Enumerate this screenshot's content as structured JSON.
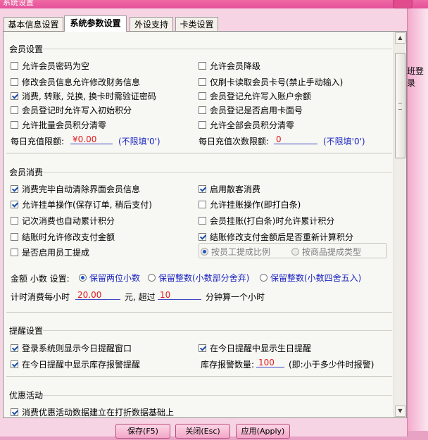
{
  "window": {
    "title": "系统设置"
  },
  "background": {
    "right_label": "班登录"
  },
  "tabs": [
    {
      "label": "基本信息设置"
    },
    {
      "label": "系统参数设置"
    },
    {
      "label": "外设支持"
    },
    {
      "label": "卡类设置"
    }
  ],
  "member_settings": {
    "title": "会员设置",
    "options": [
      {
        "label": "允许会员密码为空",
        "checked": false
      },
      {
        "label": "允许会员降级",
        "checked": false
      },
      {
        "label": "修改会员信息允许修改财务信息",
        "checked": false
      },
      {
        "label": "仅刷卡读取会员卡号(禁止手动输入)",
        "checked": false
      },
      {
        "label": "消费, 转账, 兑换, 换卡时需验证密码",
        "checked": true
      },
      {
        "label": "会员登记允许写入账户余额",
        "checked": false
      },
      {
        "label": "会员登记时允许写入初始积分",
        "checked": false
      },
      {
        "label": "会员登记是否启用卡面号",
        "checked": false
      },
      {
        "label": "允许批量会员积分清零",
        "checked": false
      },
      {
        "label": "允许全部会员积分清零",
        "checked": false
      }
    ],
    "daily_limit_label": "每日充值限额:",
    "daily_limit_value": "¥0.00",
    "daily_limit_hint": "(不限填'0')",
    "daily_count_label": "每日充值次数限额:",
    "daily_count_value": "0",
    "daily_count_hint": "(不限填'0')"
  },
  "member_consume": {
    "title": "会员消费",
    "options": [
      {
        "label": "消费完毕自动清除界面会员信息",
        "checked": true
      },
      {
        "label": "启用散客消费",
        "checked": true
      },
      {
        "label": "允许挂单操作(保存订单, 稍后支付)",
        "checked": true
      },
      {
        "label": "允许挂账操作(即打白条)",
        "checked": false
      },
      {
        "label": "记次消费也自动累计积分",
        "checked": false
      },
      {
        "label": "会员挂账(打白条)时允许累计积分",
        "checked": false
      },
      {
        "label": "结账时允许修改支付金额",
        "checked": false
      },
      {
        "label": "结账修改支付金额后是否重新计算积分",
        "checked": true
      },
      {
        "label": "是否启用员工提成",
        "checked": false
      }
    ],
    "commission_options": [
      {
        "label": "按员工提成比例",
        "selected": true
      },
      {
        "label": "按商品提成类型",
        "selected": false
      }
    ],
    "decimal_label": "金额 小数 设置:",
    "decimal_options": [
      {
        "label": "保留两位小数",
        "selected": true
      },
      {
        "label": "保留整数(小数部分舍弃)",
        "selected": false
      },
      {
        "label": "保留整数(小数四舍五入)",
        "selected": false
      }
    ],
    "hourly_label": "计时消费每小时",
    "hourly_value": "20.00",
    "hourly_mid": "元, 超过",
    "minutes_value": "10",
    "minutes_suffix": "分钟算一个小时"
  },
  "reminder": {
    "title": "提醒设置",
    "options": [
      {
        "label": "登录系统则显示今日提醒窗口",
        "checked": true
      },
      {
        "label": "在今日提醒中显示生日提醒",
        "checked": true
      },
      {
        "label": "在今日提醒中显示库存报警提醒",
        "checked": true
      }
    ],
    "stock_label": "库存报警数量:",
    "stock_value": "100",
    "stock_hint": "(即:小于多少件时报警)"
  },
  "promotion": {
    "title": "优惠活动",
    "options": [
      {
        "label": "消费优惠活动数据建立在打折数据基础上",
        "checked": true
      }
    ]
  },
  "buttons": {
    "save": "保存(F5)",
    "close": "关闭(Esc)",
    "apply": "应用(Apply)"
  }
}
